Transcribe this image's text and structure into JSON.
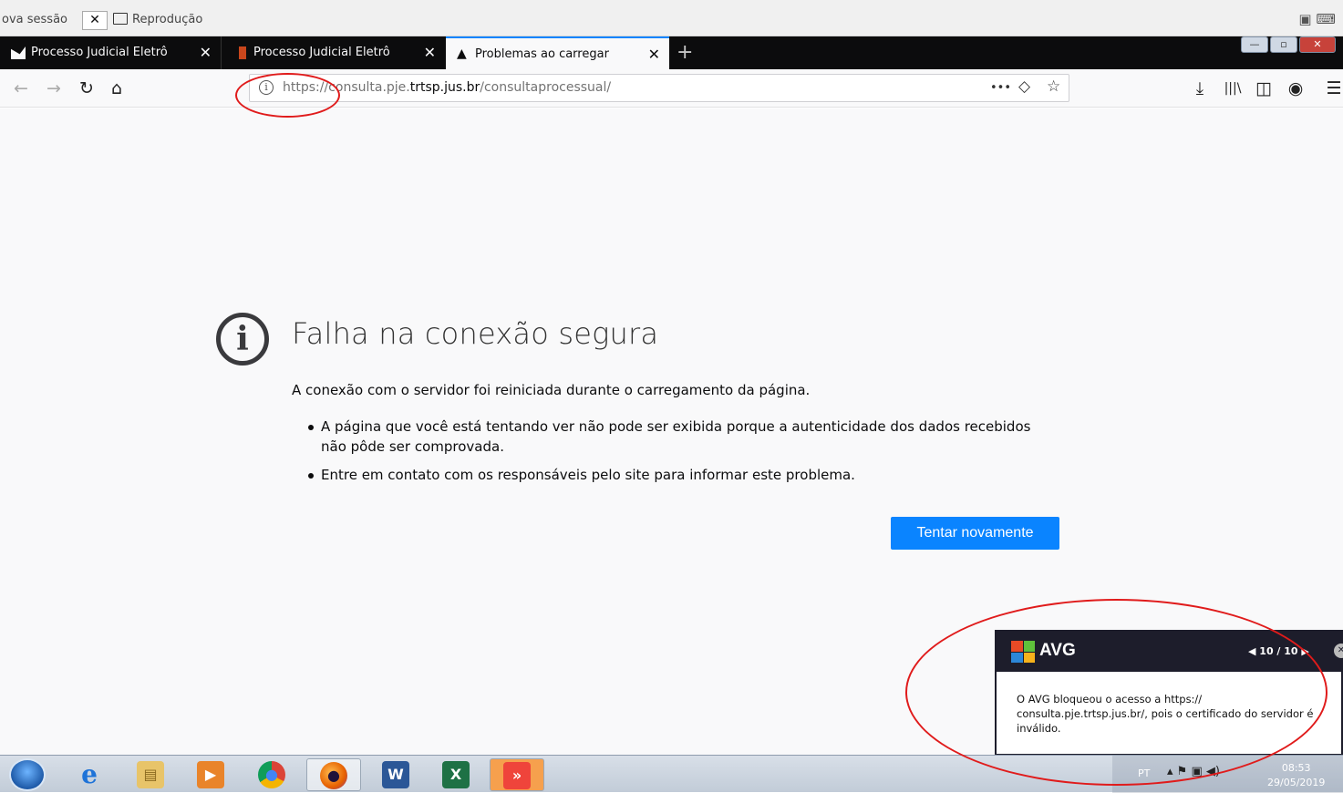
{
  "topbar": {
    "session": "ova sessão",
    "close": "✕",
    "reproduction": "Reprodução",
    "right_icons": "▣ ⌨"
  },
  "tabs": [
    {
      "label": "Processo Judicial Eletrônico - T",
      "close": "✕"
    },
    {
      "label": "Processo Judicial Eletrônico: [p",
      "close": "✕"
    },
    {
      "label": "Problemas ao carregar a página",
      "close": "✕"
    }
  ],
  "new_tab": "+",
  "window_controls": {
    "minimize": "—",
    "restore": "▫",
    "close": "✕"
  },
  "nav": {
    "back": "←",
    "forward": "→",
    "reload": "↻",
    "home": "⌂",
    "url_prefix": "https://consulta.pje.",
    "url_domain": "trtsp.jus.br",
    "url_path": "/consultaprocessual/",
    "more": "•••",
    "pocket": "◇",
    "bookmark": "☆",
    "download": "⤓",
    "library": "|||\\",
    "sidebar": "◫",
    "account": "◉",
    "menu": "☰"
  },
  "error": {
    "icon": "i",
    "title": "Falha na conexão segura",
    "description": "A conexão com o servidor foi reiniciada durante o carregamento da página.",
    "items": [
      "A página que você está tentando ver não pode ser exibida porque a autenticidade dos dados recebidos não pôde ser comprovada.",
      "Entre em contato com os responsáveis pelo site para informar este problema."
    ],
    "retry": "Tentar novamente"
  },
  "avg": {
    "name": "AVG",
    "pager": "◀ 10 / 10 ▶",
    "close": "✕",
    "message": "O AVG bloqueou o acesso a https:// consulta.pje.trtsp.jus.br/, pois o certificado do servidor é inválido."
  },
  "taskbar": {
    "apps": [
      "e",
      "▤",
      "▶",
      "●",
      "●",
      "W",
      "X",
      "»"
    ],
    "lang": "PT",
    "tray_icons": "▴ ⚑ ▣ ◀)",
    "time": "08:53",
    "date": "29/05/2019"
  },
  "colors": {
    "accent": "#0a84ff",
    "tab_strip": "#0c0c0d",
    "annotation": "#e01b1b",
    "avg_dark": "#1d1d2b"
  }
}
